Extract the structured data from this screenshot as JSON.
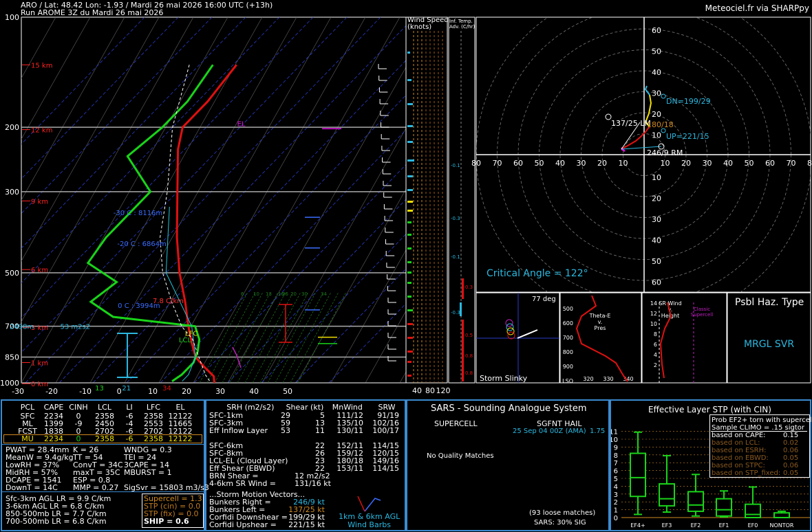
{
  "header": {
    "line1": "ARO / Lat: 48.42 Lon: -1.93 / Mardi 26 mai 2026 16:00 UTC (+13h)",
    "line2": "Run AROME 3Z du Mardi 26 mai 2026",
    "brand": "Meteociel.fr via SHARPpy"
  },
  "colors": {
    "temp": "#e01010",
    "dew": "#19d419",
    "wetbulb": "#22c4d8",
    "parcel": "#ffffff",
    "isotherm": "#2a3cc8",
    "height": "#ff2222",
    "cyan": "#2bb8e0",
    "yellow": "#f0e000",
    "orange": "#d08a20",
    "border": "#3b8bd1"
  },
  "chart_data": [
    {
      "type": "line",
      "name": "skew-t",
      "pressure_levels": [
        100,
        200,
        300,
        500,
        700,
        850,
        1000
      ],
      "x_ticks": [
        -50,
        -40,
        -30,
        -20,
        -10,
        0,
        10,
        20,
        30,
        40,
        50
      ],
      "height_labels": [
        {
          "p": 135,
          "label": "15 km"
        },
        {
          "p": 203,
          "label": "12 km"
        },
        {
          "p": 318,
          "label": "9 km"
        },
        {
          "p": 490,
          "label": "6 km"
        },
        {
          "p": 705,
          "label": "3 km"
        },
        {
          "p": 880,
          "label": "1 km"
        },
        {
          "p": 1005,
          "label": "0 km"
        }
      ],
      "series": [
        {
          "key": "temp",
          "points": [
            [
              135,
              -59
            ],
            [
              170,
              -57
            ],
            [
              200,
              -57
            ],
            [
              230,
              -52
            ],
            [
              300,
              -40
            ],
            [
              400,
              -27
            ],
            [
              500,
              -16
            ],
            [
              600,
              -6
            ],
            [
              700,
              2
            ],
            [
              780,
              8
            ],
            [
              850,
              13
            ],
            [
              900,
              18
            ],
            [
              960,
              24
            ],
            [
              1000,
              26
            ]
          ]
        },
        {
          "key": "dew",
          "points": [
            [
              135,
              -66
            ],
            [
              170,
              -63
            ],
            [
              200,
              -63
            ],
            [
              240,
              -65
            ],
            [
              300,
              -48
            ],
            [
              400,
              -48
            ],
            [
              470,
              -46
            ],
            [
              530,
              -32
            ],
            [
              600,
              -34
            ],
            [
              660,
              -23
            ],
            [
              700,
              4
            ],
            [
              760,
              9
            ],
            [
              820,
              12
            ],
            [
              880,
              14
            ],
            [
              950,
              14
            ],
            [
              990,
              13
            ]
          ]
        },
        {
          "key": "wetbulb",
          "points": [
            [
              330,
              -38
            ],
            [
              500,
              -20
            ],
            [
              700,
              3
            ],
            [
              850,
              13
            ],
            [
              950,
              16
            ],
            [
              990,
              16
            ]
          ]
        },
        {
          "key": "parcel",
          "points": [
            [
              135,
              -73
            ],
            [
              200,
              -60
            ],
            [
              300,
              -43
            ],
            [
              400,
              -32
            ],
            [
              500,
              -21
            ],
            [
              600,
              -10
            ],
            [
              700,
              0
            ],
            [
              760,
              7
            ],
            [
              850,
              14
            ],
            [
              950,
              21
            ],
            [
              1000,
              25
            ]
          ]
        }
      ],
      "annotations": [
        {
          "text": "EL",
          "p": 195,
          "x": -42,
          "color": "#e010e0"
        },
        {
          "text": "-30 C : 8116m",
          "p": 342,
          "x": -53,
          "color": "#3a6cff"
        },
        {
          "text": "-20 C : 6864m",
          "p": 415,
          "x": -43,
          "color": "#3a6cff"
        },
        {
          "text": "7.8 C/km",
          "p": 595,
          "x": -16,
          "color": "#ff3030"
        },
        {
          "text": "0 C : 3994m",
          "p": 613,
          "x": -25,
          "color": "#3a6cff"
        },
        {
          "text": "LFC",
          "p": 731,
          "x": 3,
          "color": "#f0e000"
        },
        {
          "text": "LCL",
          "p": 761,
          "x": 3,
          "color": "#19d419"
        },
        {
          "text": "2498m",
          "p": 700,
          "x": -51,
          "color": "#2bb8e0"
        },
        {
          "text": "53 m2s2",
          "p": 700,
          "x": -36,
          "color": "#2bb8e0"
        },
        {
          "text": "SFC",
          "p": 1030,
          "x": -45,
          "color": "#2bb8e0"
        },
        {
          "text": "13",
          "p": 1030,
          "x": -8,
          "color": "#19d419"
        },
        {
          "text": "21",
          "p": 1030,
          "x": 0,
          "color": "#2bb8e0"
        },
        {
          "text": "34",
          "p": 1030,
          "x": 12,
          "color": "#e01010"
        }
      ]
    },
    {
      "type": "line",
      "name": "hodograph",
      "rings": [
        10,
        20,
        30,
        40,
        50,
        60,
        70,
        80
      ],
      "axis_labels": [
        "60",
        "50",
        "40",
        "30",
        "20",
        "10",
        "10",
        "20",
        "30",
        "40",
        "50",
        "60",
        "70",
        "80",
        "90",
        "80",
        "70",
        "60",
        "50",
        "40",
        "30",
        "20",
        "10",
        "10",
        "20",
        "30",
        "40",
        "50",
        "60",
        "70",
        "80"
      ],
      "annotations": [
        {
          "text": "DN=199/29",
          "color": "#2bb8e0"
        },
        {
          "text": "137/25 LM",
          "color": "#ffffff"
        },
        {
          "text": "180/18",
          "color": "#d08a20"
        },
        {
          "text": "UP=221/15",
          "color": "#2bb8e0"
        },
        {
          "text": "246/9 RM",
          "color": "#ffffff"
        },
        {
          "text": "Critical Angle = 122°",
          "color": "#2bb8e0"
        }
      ]
    }
  ],
  "skewt_axis": {
    "p_labels": [
      "100",
      "200",
      "300",
      "500",
      "700",
      "850",
      "1000"
    ],
    "t_labels": [
      "-50",
      "-40",
      "-30",
      "-20",
      "-10",
      "0",
      "10",
      "20",
      "30",
      "40",
      "50"
    ]
  },
  "wind": {
    "title1": "Wind Speed",
    "title2": "(knots)",
    "ticks": [
      "40",
      "80",
      "120"
    ]
  },
  "inftemp": {
    "title1": "Inf. Temp.",
    "title2": "Adv. (C/hr)"
  },
  "slinky": {
    "deg": "77 deg",
    "label": "Storm Slinky"
  },
  "thetae": {
    "title": "Theta-E\nv.\nPres",
    "ticks_x": [
      "320",
      "330",
      "340"
    ],
    "ticks_y": [
      "500",
      "600",
      "700",
      "800",
      "900",
      "LSO"
    ]
  },
  "srwind": {
    "title": "SR Wind\nv.\nHeight",
    "classic": "Classic\nSupercell",
    "ticks_y": [
      "14",
      "12",
      "10",
      "8",
      "6",
      "4",
      "2"
    ]
  },
  "hazard": {
    "title": "Psbl Haz. Type",
    "value": "MRGL SVR"
  },
  "parcels": {
    "headers": [
      "PCL",
      "CAPE",
      "CINH",
      "LCL",
      "LI",
      "LFC",
      "EL"
    ],
    "rows": [
      [
        "SFC",
        "2234",
        "0",
        "2358",
        "-6",
        "2358",
        "12122"
      ],
      [
        "ML",
        "1399",
        "-9",
        "2450",
        "-4",
        "2553",
        "11665"
      ],
      [
        "FCST",
        "1838",
        "0",
        "2702",
        "-6",
        "2702",
        "12122"
      ],
      [
        "MU",
        "2234",
        "0",
        "2358",
        "-6",
        "2358",
        "12122"
      ]
    ]
  },
  "indices": [
    [
      "PWAT = 28.4mm",
      "K = 26",
      "WNDG = 0.3"
    ],
    [
      "MeanW = 9.4g/kg",
      "TT = 54",
      "TEI = 24"
    ],
    [
      "LowRH = 37%",
      "ConvT = 34C",
      "3CAPE = 14"
    ],
    [
      "MidRH = 57%",
      "maxT = 35C",
      "MBURST = 1"
    ],
    [
      "DCAPE = 1541",
      "ESP = 0.8",
      ""
    ],
    [
      "DownT = 14C",
      "MMP = 0.27",
      "SigSvr = 15803 m3/s3"
    ]
  ],
  "lapse": [
    "Sfc-3km AGL LR = 9.9 C/km",
    "3-6km AGL LR = 6.8 C/km",
    "850-500mb LR = 7.7 C/km",
    "700-500mb LR = 6.8 C/km"
  ],
  "composite": {
    "supercell": "Supercell = 1.3",
    "stpcin": "STP (cin) = 0.0",
    "stpfix": "STP (fix) = 0.0",
    "ship": "SHIP = 0.6"
  },
  "kinematics": {
    "headers": [
      "SRH (m2/s2)",
      "Shear (kt)",
      "MnWind",
      "SRW"
    ],
    "rows": [
      [
        "SFC-1km",
        "29",
        "5",
        "111/12",
        "91/19"
      ],
      [
        "SFC-3km",
        "59",
        "13",
        "135/10",
        "102/16"
      ],
      [
        "Eff Inflow Layer",
        "53",
        "11",
        "130/11",
        "100/17"
      ],
      [
        "",
        "",
        "",
        "",
        ""
      ],
      [
        "SFC-6km",
        "",
        "22",
        "152/11",
        "114/15"
      ],
      [
        "SFC-8km",
        "",
        "26",
        "159/12",
        "120/15"
      ],
      [
        "LCL-EL (Cloud Layer)",
        "",
        "23",
        "180/18",
        "149/16"
      ],
      [
        "Eff Shear (EBWD)",
        "",
        "22",
        "153/11",
        "114/15"
      ]
    ],
    "brn": [
      "BRN Shear =",
      "12 m2/s2"
    ],
    "srwind": [
      "4-6km SR Wind =",
      "131/16 kt"
    ],
    "vectors_title": "...Storm Motion Vectors...",
    "vectors": [
      [
        "Bunkers Right =",
        "246/9 kt"
      ],
      [
        "Bunkers Left =",
        "137/25 kt"
      ],
      [
        "Corfidi Downshear =",
        "199/29 kt"
      ],
      [
        "Corfidi Upshear =",
        "221/15 kt"
      ]
    ],
    "barbs_label": "1km & 6km AGL\nWind Barbs"
  },
  "sars": {
    "title": "SARS - Sounding Analogue System",
    "col1": "SUPERCELL",
    "col2": "SGFNT HAIL",
    "match": "25 Sep 04 00Z (AMA)",
    "match_val": "1.75",
    "noquality": "No Quality Matches",
    "loose": "(93 loose matches)",
    "sig": "SARS: 30% SIG"
  },
  "stp": {
    "title": "Effective Layer STP (with CIN)",
    "yticks": [
      "0",
      "1",
      "2",
      "3",
      "4",
      "5",
      "6",
      "7",
      "8",
      "9",
      "10",
      "11"
    ],
    "categories": [
      "EF4+",
      "EF3",
      "EF2",
      "EF1",
      "EF0",
      "NONTOR"
    ],
    "boxes": [
      {
        "lo": 0.4,
        "q1": 2.7,
        "med": 5.1,
        "q3": 8.2,
        "hi": 10.9
      },
      {
        "lo": 0.7,
        "q1": 1.5,
        "med": 2.4,
        "q3": 4.3,
        "hi": 7.9
      },
      {
        "lo": 0.2,
        "q1": 0.8,
        "med": 1.6,
        "q3": 3.3,
        "hi": 5.5
      },
      {
        "lo": 0.1,
        "q1": 0.2,
        "med": 1.0,
        "q3": 2.4,
        "hi": 3.4
      },
      {
        "lo": 0.0,
        "q1": 0.0,
        "med": 0.4,
        "q3": 1.7,
        "hi": 3.9
      },
      {
        "lo": 0.0,
        "q1": 0.0,
        "med": 0.0,
        "q3": 0.6,
        "hi": 0.8
      }
    ],
    "prob_title": "Prob EF2+ torn with supercell",
    "prob_sub": "Sample CLIMO = .15 sigtor",
    "prob_rows": [
      [
        "based on CAPE:",
        "0.15"
      ],
      [
        "based on LCL:",
        "0.02"
      ],
      [
        "based on ESRH:",
        "0.06"
      ],
      [
        "based on EBWD:",
        "0.05"
      ],
      [
        "based on STPC:",
        "0.06"
      ],
      [
        "based on STP_fixed:",
        "0.05"
      ]
    ]
  }
}
